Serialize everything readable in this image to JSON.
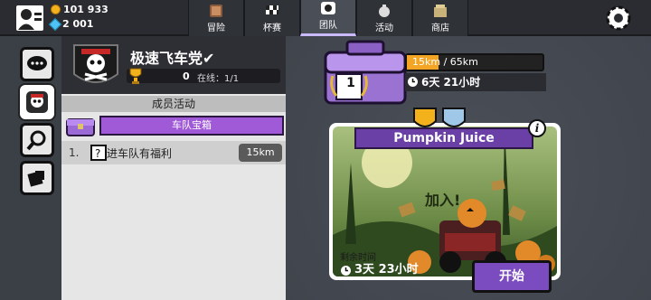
{
  "currency": {
    "coins": "101 933",
    "gems": "2 001"
  },
  "tabs": [
    {
      "label": "冒险",
      "active": false
    },
    {
      "label": "杯赛",
      "active": false
    },
    {
      "label": "团队",
      "active": true
    },
    {
      "label": "活动",
      "active": false
    },
    {
      "label": "商店",
      "active": false
    }
  ],
  "team": {
    "name": "极速飞车党✔",
    "trophies": "0",
    "online": "在线：1/1"
  },
  "activity": {
    "section_title": "成员活动",
    "chest_label": "车队宝箱",
    "tasks": [
      {
        "index": "1.",
        "label": "进车队有福利",
        "km": "15km"
      }
    ]
  },
  "chest_progress": {
    "level": "1",
    "text": "15km / 65km",
    "progress": 0.23,
    "timer": "6天 21小时"
  },
  "event": {
    "title": "Pumpkin Juice",
    "join_text": "加入!",
    "remaining_label": "剩余时间",
    "remaining_time": "3天 23小时",
    "start_label": "开始"
  },
  "colors": {
    "accent": "#7b4bc0",
    "progress": "#f5a524",
    "coin": "#f3b21b",
    "gem": "#4fc3f7"
  }
}
